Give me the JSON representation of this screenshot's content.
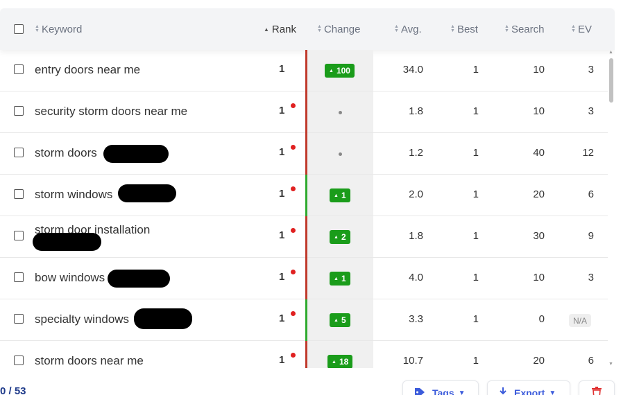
{
  "header": {
    "keyword": "Keyword",
    "rank": "Rank",
    "change": "Change",
    "avg": "Avg.",
    "best": "Best",
    "search": "Search",
    "ev": "EV"
  },
  "rows": [
    {
      "keyword": "entry doors near me",
      "rank": "1",
      "change": "100",
      "avg": "34.0",
      "best": "1",
      "search": "10",
      "ev": "3"
    },
    {
      "keyword": "security storm doors near me",
      "rank": "1",
      "change": "•",
      "avg": "1.8",
      "best": "1",
      "search": "10",
      "ev": "3"
    },
    {
      "keyword": "storm doors",
      "rank": "1",
      "change": "•",
      "avg": "1.2",
      "best": "1",
      "search": "40",
      "ev": "12"
    },
    {
      "keyword": "storm windows",
      "rank": "1",
      "change": "1",
      "avg": "2.0",
      "best": "1",
      "search": "20",
      "ev": "6"
    },
    {
      "keyword": "storm door installation",
      "rank": "1",
      "change": "2",
      "avg": "1.8",
      "best": "1",
      "search": "30",
      "ev": "9"
    },
    {
      "keyword": "bow windows",
      "rank": "1",
      "change": "1",
      "avg": "4.0",
      "best": "1",
      "search": "10",
      "ev": "3"
    },
    {
      "keyword": "specialty windows",
      "rank": "1",
      "change": "5",
      "avg": "3.3",
      "best": "1",
      "search": "0",
      "ev": "N/A"
    },
    {
      "keyword": "storm doors near me",
      "rank": "1",
      "change": "18",
      "avg": "10.7",
      "best": "1",
      "search": "20",
      "ev": "6"
    }
  ],
  "footer": {
    "count": "0 / 53",
    "tags": "Tags",
    "export": "Export"
  },
  "colors": {
    "change_badge": "#1a9c1a",
    "rank_dot": "#e02020",
    "bar_red": "#c0392b",
    "bar_green": "#2eaa2e",
    "accent": "#3b5bdb"
  },
  "icons": {
    "sort": "sort-arrows-icon",
    "tag": "tag-icon",
    "export": "download-icon",
    "delete": "trash-icon"
  }
}
